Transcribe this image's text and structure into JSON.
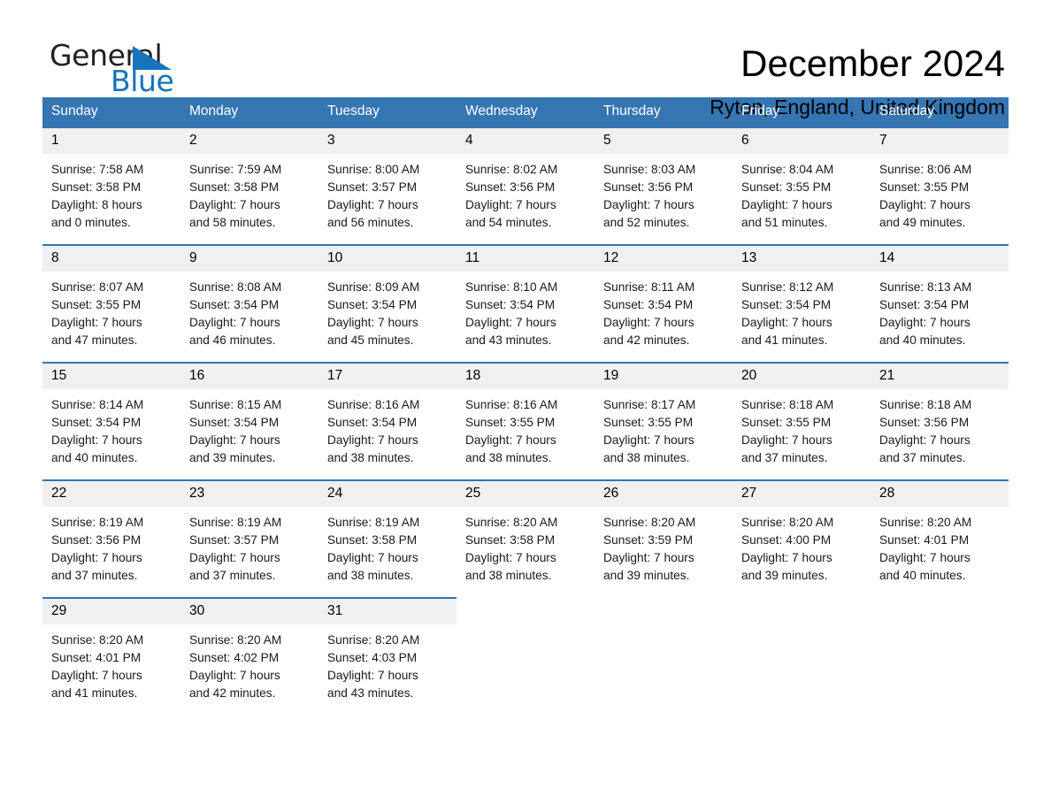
{
  "brand": {
    "name_part1": "General",
    "name_part2": "Blue",
    "accent_color": "#1574bb"
  },
  "header": {
    "title": "December 2024",
    "location": "Ryton, England, United Kingdom"
  },
  "theme": {
    "header_blue": "#3575b2",
    "daynum_bg": "#f0f0f0",
    "cell_bg": "#ffffff"
  },
  "calendar": {
    "weekday_headers": [
      "Sunday",
      "Monday",
      "Tuesday",
      "Wednesday",
      "Thursday",
      "Friday",
      "Saturday"
    ],
    "weeks": [
      [
        {
          "day": "1",
          "sunrise": "Sunrise: 7:58 AM",
          "sunset": "Sunset: 3:58 PM",
          "daylight_line1": "Daylight: 8 hours",
          "daylight_line2": "and 0 minutes."
        },
        {
          "day": "2",
          "sunrise": "Sunrise: 7:59 AM",
          "sunset": "Sunset: 3:58 PM",
          "daylight_line1": "Daylight: 7 hours",
          "daylight_line2": "and 58 minutes."
        },
        {
          "day": "3",
          "sunrise": "Sunrise: 8:00 AM",
          "sunset": "Sunset: 3:57 PM",
          "daylight_line1": "Daylight: 7 hours",
          "daylight_line2": "and 56 minutes."
        },
        {
          "day": "4",
          "sunrise": "Sunrise: 8:02 AM",
          "sunset": "Sunset: 3:56 PM",
          "daylight_line1": "Daylight: 7 hours",
          "daylight_line2": "and 54 minutes."
        },
        {
          "day": "5",
          "sunrise": "Sunrise: 8:03 AM",
          "sunset": "Sunset: 3:56 PM",
          "daylight_line1": "Daylight: 7 hours",
          "daylight_line2": "and 52 minutes."
        },
        {
          "day": "6",
          "sunrise": "Sunrise: 8:04 AM",
          "sunset": "Sunset: 3:55 PM",
          "daylight_line1": "Daylight: 7 hours",
          "daylight_line2": "and 51 minutes."
        },
        {
          "day": "7",
          "sunrise": "Sunrise: 8:06 AM",
          "sunset": "Sunset: 3:55 PM",
          "daylight_line1": "Daylight: 7 hours",
          "daylight_line2": "and 49 minutes."
        }
      ],
      [
        {
          "day": "8",
          "sunrise": "Sunrise: 8:07 AM",
          "sunset": "Sunset: 3:55 PM",
          "daylight_line1": "Daylight: 7 hours",
          "daylight_line2": "and 47 minutes."
        },
        {
          "day": "9",
          "sunrise": "Sunrise: 8:08 AM",
          "sunset": "Sunset: 3:54 PM",
          "daylight_line1": "Daylight: 7 hours",
          "daylight_line2": "and 46 minutes."
        },
        {
          "day": "10",
          "sunrise": "Sunrise: 8:09 AM",
          "sunset": "Sunset: 3:54 PM",
          "daylight_line1": "Daylight: 7 hours",
          "daylight_line2": "and 45 minutes."
        },
        {
          "day": "11",
          "sunrise": "Sunrise: 8:10 AM",
          "sunset": "Sunset: 3:54 PM",
          "daylight_line1": "Daylight: 7 hours",
          "daylight_line2": "and 43 minutes."
        },
        {
          "day": "12",
          "sunrise": "Sunrise: 8:11 AM",
          "sunset": "Sunset: 3:54 PM",
          "daylight_line1": "Daylight: 7 hours",
          "daylight_line2": "and 42 minutes."
        },
        {
          "day": "13",
          "sunrise": "Sunrise: 8:12 AM",
          "sunset": "Sunset: 3:54 PM",
          "daylight_line1": "Daylight: 7 hours",
          "daylight_line2": "and 41 minutes."
        },
        {
          "day": "14",
          "sunrise": "Sunrise: 8:13 AM",
          "sunset": "Sunset: 3:54 PM",
          "daylight_line1": "Daylight: 7 hours",
          "daylight_line2": "and 40 minutes."
        }
      ],
      [
        {
          "day": "15",
          "sunrise": "Sunrise: 8:14 AM",
          "sunset": "Sunset: 3:54 PM",
          "daylight_line1": "Daylight: 7 hours",
          "daylight_line2": "and 40 minutes."
        },
        {
          "day": "16",
          "sunrise": "Sunrise: 8:15 AM",
          "sunset": "Sunset: 3:54 PM",
          "daylight_line1": "Daylight: 7 hours",
          "daylight_line2": "and 39 minutes."
        },
        {
          "day": "17",
          "sunrise": "Sunrise: 8:16 AM",
          "sunset": "Sunset: 3:54 PM",
          "daylight_line1": "Daylight: 7 hours",
          "daylight_line2": "and 38 minutes."
        },
        {
          "day": "18",
          "sunrise": "Sunrise: 8:16 AM",
          "sunset": "Sunset: 3:55 PM",
          "daylight_line1": "Daylight: 7 hours",
          "daylight_line2": "and 38 minutes."
        },
        {
          "day": "19",
          "sunrise": "Sunrise: 8:17 AM",
          "sunset": "Sunset: 3:55 PM",
          "daylight_line1": "Daylight: 7 hours",
          "daylight_line2": "and 38 minutes."
        },
        {
          "day": "20",
          "sunrise": "Sunrise: 8:18 AM",
          "sunset": "Sunset: 3:55 PM",
          "daylight_line1": "Daylight: 7 hours",
          "daylight_line2": "and 37 minutes."
        },
        {
          "day": "21",
          "sunrise": "Sunrise: 8:18 AM",
          "sunset": "Sunset: 3:56 PM",
          "daylight_line1": "Daylight: 7 hours",
          "daylight_line2": "and 37 minutes."
        }
      ],
      [
        {
          "day": "22",
          "sunrise": "Sunrise: 8:19 AM",
          "sunset": "Sunset: 3:56 PM",
          "daylight_line1": "Daylight: 7 hours",
          "daylight_line2": "and 37 minutes."
        },
        {
          "day": "23",
          "sunrise": "Sunrise: 8:19 AM",
          "sunset": "Sunset: 3:57 PM",
          "daylight_line1": "Daylight: 7 hours",
          "daylight_line2": "and 37 minutes."
        },
        {
          "day": "24",
          "sunrise": "Sunrise: 8:19 AM",
          "sunset": "Sunset: 3:58 PM",
          "daylight_line1": "Daylight: 7 hours",
          "daylight_line2": "and 38 minutes."
        },
        {
          "day": "25",
          "sunrise": "Sunrise: 8:20 AM",
          "sunset": "Sunset: 3:58 PM",
          "daylight_line1": "Daylight: 7 hours",
          "daylight_line2": "and 38 minutes."
        },
        {
          "day": "26",
          "sunrise": "Sunrise: 8:20 AM",
          "sunset": "Sunset: 3:59 PM",
          "daylight_line1": "Daylight: 7 hours",
          "daylight_line2": "and 39 minutes."
        },
        {
          "day": "27",
          "sunrise": "Sunrise: 8:20 AM",
          "sunset": "Sunset: 4:00 PM",
          "daylight_line1": "Daylight: 7 hours",
          "daylight_line2": "and 39 minutes."
        },
        {
          "day": "28",
          "sunrise": "Sunrise: 8:20 AM",
          "sunset": "Sunset: 4:01 PM",
          "daylight_line1": "Daylight: 7 hours",
          "daylight_line2": "and 40 minutes."
        }
      ],
      [
        {
          "day": "29",
          "sunrise": "Sunrise: 8:20 AM",
          "sunset": "Sunset: 4:01 PM",
          "daylight_line1": "Daylight: 7 hours",
          "daylight_line2": "and 41 minutes."
        },
        {
          "day": "30",
          "sunrise": "Sunrise: 8:20 AM",
          "sunset": "Sunset: 4:02 PM",
          "daylight_line1": "Daylight: 7 hours",
          "daylight_line2": "and 42 minutes."
        },
        {
          "day": "31",
          "sunrise": "Sunrise: 8:20 AM",
          "sunset": "Sunset: 4:03 PM",
          "daylight_line1": "Daylight: 7 hours",
          "daylight_line2": "and 43 minutes."
        },
        {
          "day": "",
          "sunrise": "",
          "sunset": "",
          "daylight_line1": "",
          "daylight_line2": ""
        },
        {
          "day": "",
          "sunrise": "",
          "sunset": "",
          "daylight_line1": "",
          "daylight_line2": ""
        },
        {
          "day": "",
          "sunrise": "",
          "sunset": "",
          "daylight_line1": "",
          "daylight_line2": ""
        },
        {
          "day": "",
          "sunrise": "",
          "sunset": "",
          "daylight_line1": "",
          "daylight_line2": ""
        }
      ]
    ]
  }
}
